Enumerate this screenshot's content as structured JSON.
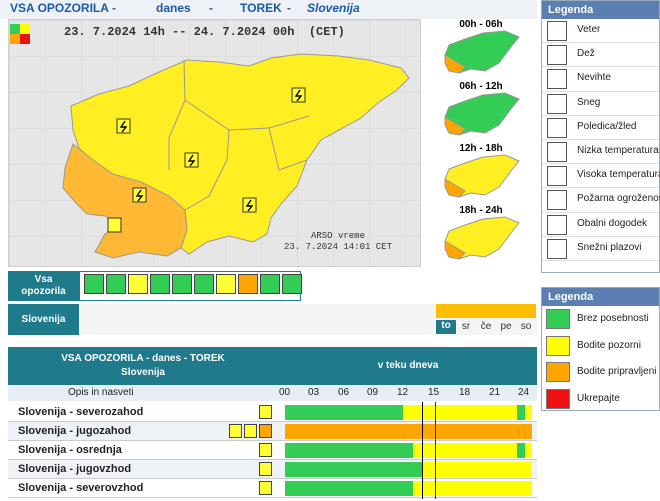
{
  "header": {
    "title": "VSA OPOZORILA",
    "sep1": "-",
    "when": "danes",
    "sep2": "-",
    "day": "TOREK",
    "sep3": "-",
    "region": "Slovenija"
  },
  "map": {
    "date_range": "23. 7.2024 14h -- 24. 7.2024 00h",
    "tz": "(CET)",
    "arso": "ARSO vreme",
    "arso_time": "23. 7.2024 14:01 CET"
  },
  "mini_maps": [
    {
      "label": "00h - 06h",
      "main": "green",
      "corner": "orange"
    },
    {
      "label": "06h - 12h",
      "main": "green",
      "corner": "orange"
    },
    {
      "label": "12h - 18h",
      "main": "yellow",
      "corner": "orange"
    },
    {
      "label": "18h - 24h",
      "main": "yellow",
      "corner": "orange"
    }
  ],
  "legend1": {
    "title": "Legenda",
    "items": [
      {
        "label": "Veter",
        "icon": "wind-icon"
      },
      {
        "label": "Dež",
        "icon": "rain-icon"
      },
      {
        "label": "Nevihte",
        "icon": "thunderstorm-icon"
      },
      {
        "label": "Sneg",
        "icon": "snow-icon"
      },
      {
        "label": "Poledica/žled",
        "icon": "ice-icon"
      },
      {
        "label": "Nizka temperatura",
        "icon": "low-temp-icon"
      },
      {
        "label": "Visoka temperatura",
        "icon": "high-temp-icon"
      },
      {
        "label": "Požarna ogroženost",
        "icon": "fire-icon"
      },
      {
        "label": "Obalni dogodek",
        "icon": "coastal-icon"
      },
      {
        "label": "Snežni plazovi",
        "icon": "avalanche-icon"
      }
    ]
  },
  "legend2": {
    "title": "Legenda",
    "items": [
      {
        "label": "Brez posebnosti",
        "color": "#33cc55"
      },
      {
        "label": "Bodite pozorni",
        "color": "#ffff00"
      },
      {
        "label": "Bodite pripravljeni",
        "color": "#ffa500"
      },
      {
        "label": "Ukrepajte",
        "color": "#ee1111"
      }
    ]
  },
  "strip": {
    "label_line1": "Vsa",
    "label_line2": "opozorila",
    "slovenija": "Slovenija",
    "days": [
      "to",
      "sr",
      "če",
      "pe",
      "so"
    ]
  },
  "table": {
    "head_line1": "VSA OPOZORILA - danes - TOREK",
    "head_line2": "Slovenija",
    "head_right": "v teku dneva",
    "sub_left": "Opis in nasveti",
    "hours": [
      "00",
      "03",
      "06",
      "09",
      "12",
      "15",
      "18",
      "21",
      "24"
    ],
    "rows": [
      {
        "name": "Slovenija - severozahod"
      },
      {
        "name": "Slovenija - jugozahod"
      },
      {
        "name": "Slovenija - osrednja"
      },
      {
        "name": "Slovenija - jugovzhod"
      },
      {
        "name": "Slovenija - severovzhod"
      }
    ]
  }
}
